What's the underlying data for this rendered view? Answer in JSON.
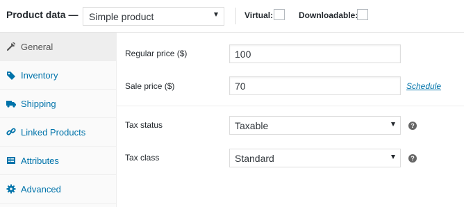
{
  "header": {
    "title": "Product data —",
    "product_type": "Simple product",
    "virtual_label": "Virtual:",
    "downloadable_label": "Downloadable:"
  },
  "sidebar": {
    "tabs": [
      {
        "label": "General",
        "icon": "wrench-icon",
        "active": true
      },
      {
        "label": "Inventory",
        "icon": "tag-icon",
        "active": false
      },
      {
        "label": "Shipping",
        "icon": "truck-icon",
        "active": false
      },
      {
        "label": "Linked Products",
        "icon": "link-icon",
        "active": false
      },
      {
        "label": "Attributes",
        "icon": "list-icon",
        "active": false
      },
      {
        "label": "Advanced",
        "icon": "gear-icon",
        "active": false
      }
    ]
  },
  "general": {
    "regular_price_label": "Regular price ($)",
    "regular_price_value": "100",
    "sale_price_label": "Sale price ($)",
    "sale_price_value": "70",
    "schedule_link": "Schedule",
    "tax_status_label": "Tax status",
    "tax_status_value": "Taxable",
    "tax_class_label": "Tax class",
    "tax_class_value": "Standard",
    "help_glyph": "?"
  },
  "colors": {
    "link": "#0073aa",
    "sidebar_bg": "#fafafa",
    "active_tab_bg": "#eeeeee",
    "text": "#23282d"
  }
}
